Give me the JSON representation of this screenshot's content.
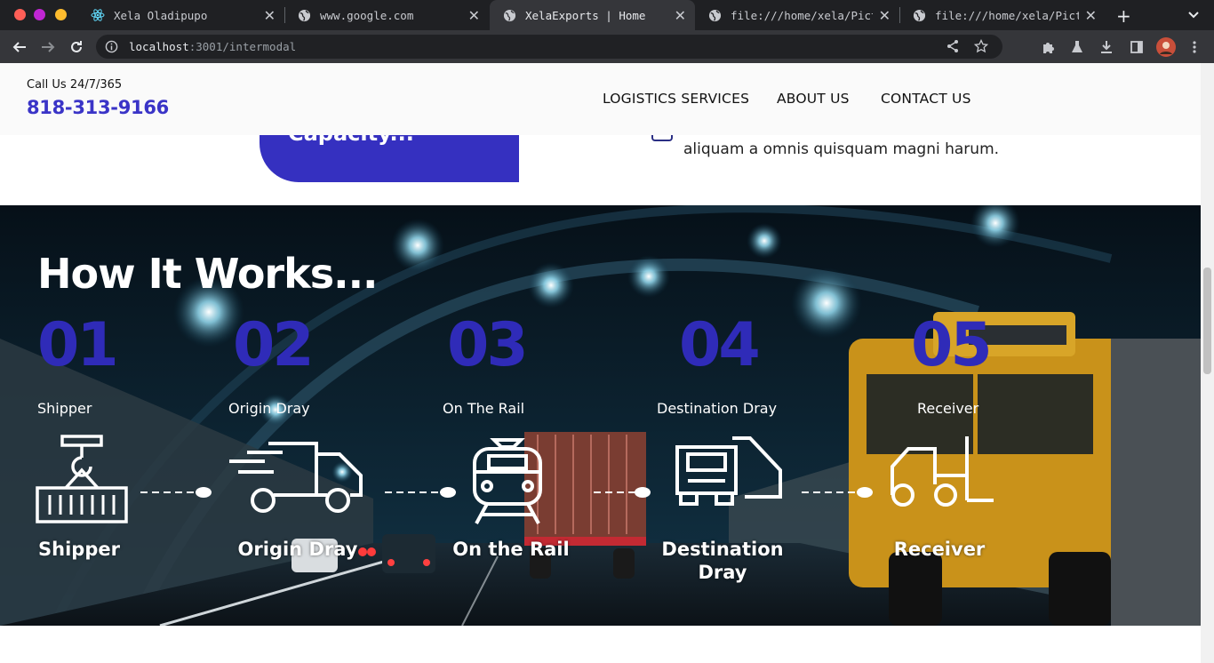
{
  "browser": {
    "tabs": [
      {
        "title": "Xela Oladipupo",
        "icon": "react-icon"
      },
      {
        "title": "www.google.com",
        "icon": "globe-icon"
      },
      {
        "title": "XelaExports | Home",
        "icon": "globe-icon",
        "active": true
      },
      {
        "title": "file:///home/xela/Pictur",
        "icon": "globe-icon"
      },
      {
        "title": "file:///home/xela/Pictur",
        "icon": "globe-icon"
      }
    ],
    "url_host": "localhost",
    "url_path": ":3001/intermodal"
  },
  "header": {
    "call_label": "Call Us 24/7/365",
    "phone": "818-313-9166",
    "nav": [
      "LOGISTICS SERVICES",
      "ABOUT US",
      "CONTACT US"
    ]
  },
  "intro": {
    "card_text": "Capacity...",
    "paragraph_tail": "aliquam a omnis quisquam magni harum."
  },
  "how_it_works": {
    "title": "How It Works...",
    "steps": [
      {
        "number": "01",
        "label": "Shipper",
        "caption": "Shipper",
        "icon": "crane-container-icon"
      },
      {
        "number": "02",
        "label": "Origin Dray",
        "caption": "Origin Dray",
        "icon": "fast-truck-icon"
      },
      {
        "number": "03",
        "label": "On The Rail",
        "caption": "On the Rail",
        "icon": "train-icon"
      },
      {
        "number": "04",
        "label": "Destination Dray",
        "caption": "Destination Dray",
        "icon": "semi-truck-icon"
      },
      {
        "number": "05",
        "label": "Receiver",
        "caption": "Receiver",
        "icon": "forklift-icon"
      }
    ]
  },
  "colors": {
    "accent_blue": "#3530c0",
    "phone_blue": "#3a34c7",
    "number_blue": "#2f2bb8",
    "chrome_dark": "#1f2023"
  }
}
